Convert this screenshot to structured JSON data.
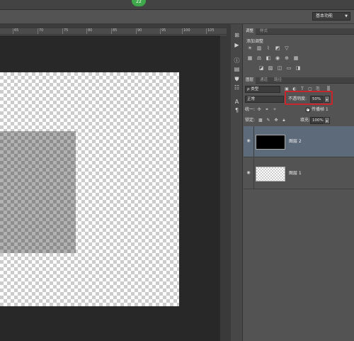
{
  "app": {
    "badge": "22",
    "workspace_label": "基本功能"
  },
  "ruler": {
    "ticks": [
      "65",
      "70",
      "75",
      "80",
      "85",
      "90",
      "95",
      "100",
      "105"
    ]
  },
  "adjustments_panel": {
    "tabs": [
      "调整",
      "样式"
    ],
    "title": "添加调整"
  },
  "layers_panel": {
    "tabs": [
      "图层",
      "通道",
      "路径"
    ],
    "filter_kind": "ρ 类型",
    "blend_mode": "正常",
    "opacity_label": "不透明度:",
    "opacity_value": "50%",
    "unify_label": "统一:",
    "propagate_label": "传播帧 1",
    "lock_label": "锁定:",
    "fill_label": "填充:",
    "fill_value": "100%",
    "layers": [
      {
        "name": "图层 2",
        "selected": true,
        "thumbnail": "black"
      },
      {
        "name": "图层 1",
        "selected": false,
        "thumbnail": "transparent"
      }
    ]
  },
  "icons": {
    "eye": "eye-icon",
    "dropdown": "chevron-down-icon",
    "checkbox": "checkbox-checked-icon"
  },
  "colors": {
    "accent_highlight": "#c8262d",
    "selected_layer": "#5d6a7a",
    "badge": "#3ea84a"
  }
}
